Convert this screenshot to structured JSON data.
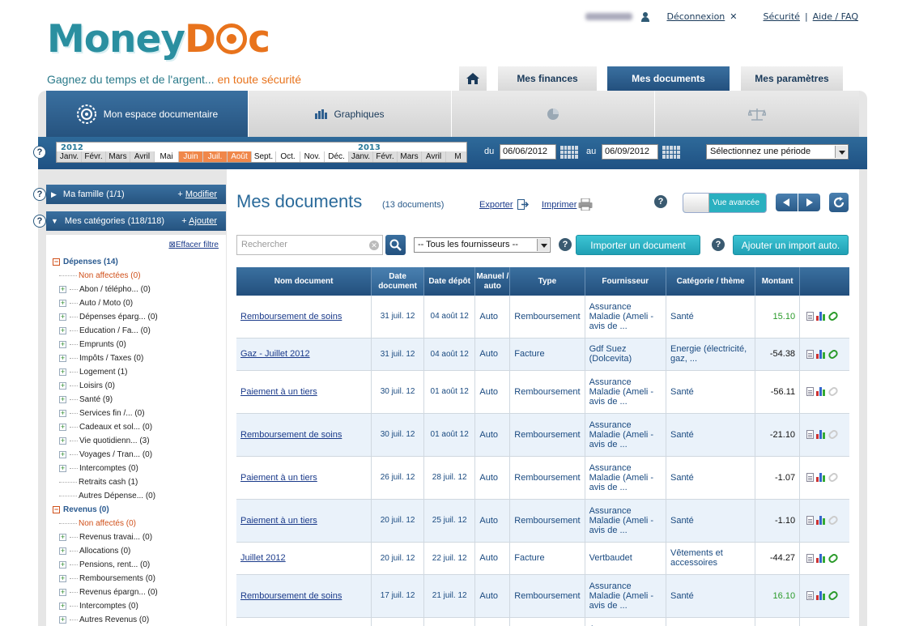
{
  "brand": {
    "name_part1": "Money",
    "name_part2": "D",
    "name_part3": "c",
    "tagline_main": "Gagnez du temps et de l'argent...",
    "tagline_accent": " en toute sécurité"
  },
  "toplinks": {
    "logout": "Déconnexion",
    "security": "Sécurité",
    "separator": "|",
    "help": "Aide / FAQ"
  },
  "main_tabs": [
    {
      "label": "Mes finances"
    },
    {
      "label": "Mes documents",
      "active": true
    },
    {
      "label": "Mes paramètres"
    }
  ],
  "sub_tabs": [
    {
      "label": "Mon espace documentaire",
      "active": true
    },
    {
      "label": "Graphiques"
    },
    {
      "label": ""
    },
    {
      "label": ""
    }
  ],
  "timeline": {
    "years": [
      "2012",
      "2013"
    ],
    "months": [
      "Janv.",
      "Févr.",
      "Mars",
      "Avril",
      "Mai",
      "Juin",
      "Juil.",
      "Août",
      "Sept.",
      "Oct.",
      "Nov.",
      "Déc.",
      "Janv.",
      "Févr.",
      "Mars",
      "Avril",
      "M"
    ],
    "selected_range": "Juin – Août 2012"
  },
  "dates": {
    "from_label": "du",
    "from": "06/06/2012",
    "to_label": "au",
    "to": "06/09/2012",
    "period_placeholder": "Sélectionnez une période"
  },
  "sidebar": {
    "famille": {
      "label": "Ma famille (1/1)",
      "action": "Modifier"
    },
    "categories": {
      "label": "Mes catégories (118/118)",
      "action": "Ajouter"
    },
    "clear_filter": "Effacer filtre",
    "tree": [
      {
        "label": "Dépenses (14)",
        "type": "group"
      },
      {
        "label": "Non affectées (0)",
        "type": "red"
      },
      {
        "label": "Abon / télépho... (0)",
        "type": "item"
      },
      {
        "label": "Auto / Moto (0)",
        "type": "item"
      },
      {
        "label": "Dépenses éparg... (0)",
        "type": "item"
      },
      {
        "label": "Education / Fa... (0)",
        "type": "item"
      },
      {
        "label": "Emprunts (0)",
        "type": "item"
      },
      {
        "label": "Impôts / Taxes (0)",
        "type": "item"
      },
      {
        "label": "Logement (1)",
        "type": "item"
      },
      {
        "label": "Loisirs (0)",
        "type": "item"
      },
      {
        "label": "Santé (9)",
        "type": "item"
      },
      {
        "label": "Services fin /... (0)",
        "type": "item"
      },
      {
        "label": "Cadeaux et sol... (0)",
        "type": "item"
      },
      {
        "label": "Vie quotidienn... (3)",
        "type": "item"
      },
      {
        "label": "Voyages / Tran... (0)",
        "type": "item"
      },
      {
        "label": "Intercomptes (0)",
        "type": "item"
      },
      {
        "label": "Retraits cash (1)",
        "type": "leaf"
      },
      {
        "label": "Autres Dépense... (0)",
        "type": "leaf"
      },
      {
        "label": "Revenus (0)",
        "type": "group"
      },
      {
        "label": "Non affectés (0)",
        "type": "red"
      },
      {
        "label": "Revenus travai... (0)",
        "type": "item"
      },
      {
        "label": "Allocations (0)",
        "type": "item"
      },
      {
        "label": "Pensions, rent... (0)",
        "type": "item"
      },
      {
        "label": "Remboursements (0)",
        "type": "item"
      },
      {
        "label": "Revenus épargn... (0)",
        "type": "item"
      },
      {
        "label": "Intercomptes (0)",
        "type": "item"
      },
      {
        "label": "Autres Revenus (0)",
        "type": "item"
      }
    ]
  },
  "content": {
    "title": "Mes documents",
    "count": "(13 documents)",
    "export": "Exporter",
    "print": "Imprimer",
    "advanced_toggle": "Vue avancée",
    "search_placeholder": "Rechercher",
    "supplier_filter": "-- Tous les fournisseurs --",
    "import_btn": "Importer un document",
    "auto_import_btn": "Ajouter un import auto."
  },
  "table": {
    "headers": [
      "Nom document",
      "Date document",
      "Date dépôt",
      "Manuel / auto",
      "Type",
      "Fournisseur",
      "Catégorie / thème",
      "Montant",
      ""
    ],
    "rows": [
      {
        "name": "Remboursement de soins",
        "date": "31 juil. 12",
        "depot": "04 août 12",
        "mode": "Auto",
        "type": "Remboursement",
        "supplier": "Assurance Maladie (Ameli - avis de ...",
        "category": "Santé",
        "amount": "15.10",
        "positive": true,
        "clip": true
      },
      {
        "name": "Gaz - Juillet 2012",
        "date": "31 juil. 12",
        "depot": "04 août 12",
        "mode": "Auto",
        "type": "Facture",
        "supplier": "Gdf Suez (Dolcevita)",
        "category": "Energie (électricité, gaz, ...",
        "amount": "-54.38",
        "positive": false,
        "clip": true
      },
      {
        "name": "Paiement à un tiers",
        "date": "30 juil. 12",
        "depot": "01 août 12",
        "mode": "Auto",
        "type": "Remboursement",
        "supplier": "Assurance Maladie (Ameli - avis de ...",
        "category": "Santé",
        "amount": "-56.11",
        "positive": false,
        "clip": false
      },
      {
        "name": "Remboursement de soins",
        "date": "30 juil. 12",
        "depot": "01 août 12",
        "mode": "Auto",
        "type": "Remboursement",
        "supplier": "Assurance Maladie (Ameli - avis de ...",
        "category": "Santé",
        "amount": "-21.10",
        "positive": false,
        "clip": false
      },
      {
        "name": "Paiement à un tiers",
        "date": "26 juil. 12",
        "depot": "28 juil. 12",
        "mode": "Auto",
        "type": "Remboursement",
        "supplier": "Assurance Maladie (Ameli - avis de ...",
        "category": "Santé",
        "amount": "-1.07",
        "positive": false,
        "clip": false
      },
      {
        "name": "Paiement à un tiers",
        "date": "20 juil. 12",
        "depot": "25 juil. 12",
        "mode": "Auto",
        "type": "Remboursement",
        "supplier": "Assurance Maladie (Ameli - avis de ...",
        "category": "Santé",
        "amount": "-1.10",
        "positive": false,
        "clip": false
      },
      {
        "name": "Juillet 2012",
        "date": "20 juil. 12",
        "depot": "22 juil. 12",
        "mode": "Auto",
        "type": "Facture",
        "supplier": "Vertbaudet",
        "category": "Vêtements et accessoires",
        "amount": "-44.27",
        "positive": false,
        "clip": true
      },
      {
        "name": "Remboursement de soins",
        "date": "17 juil. 12",
        "depot": "21 juil. 12",
        "mode": "Auto",
        "type": "Remboursement",
        "supplier": "Assurance Maladie (Ameli - avis de ...",
        "category": "Santé",
        "amount": "16.10",
        "positive": true,
        "clip": true
      },
      {
        "name": "",
        "date": "",
        "depot": "",
        "mode": "",
        "type": "",
        "supplier": "Assurance",
        "category": "",
        "amount": "",
        "positive": false,
        "clip": false
      }
    ]
  },
  "colors": {
    "brand_teal": "#2a8fa0",
    "brand_orange": "#e8731c",
    "nav_blue": "#2e5f8f",
    "action_teal": "#2ab0c0",
    "positive": "#2a9a2a"
  }
}
